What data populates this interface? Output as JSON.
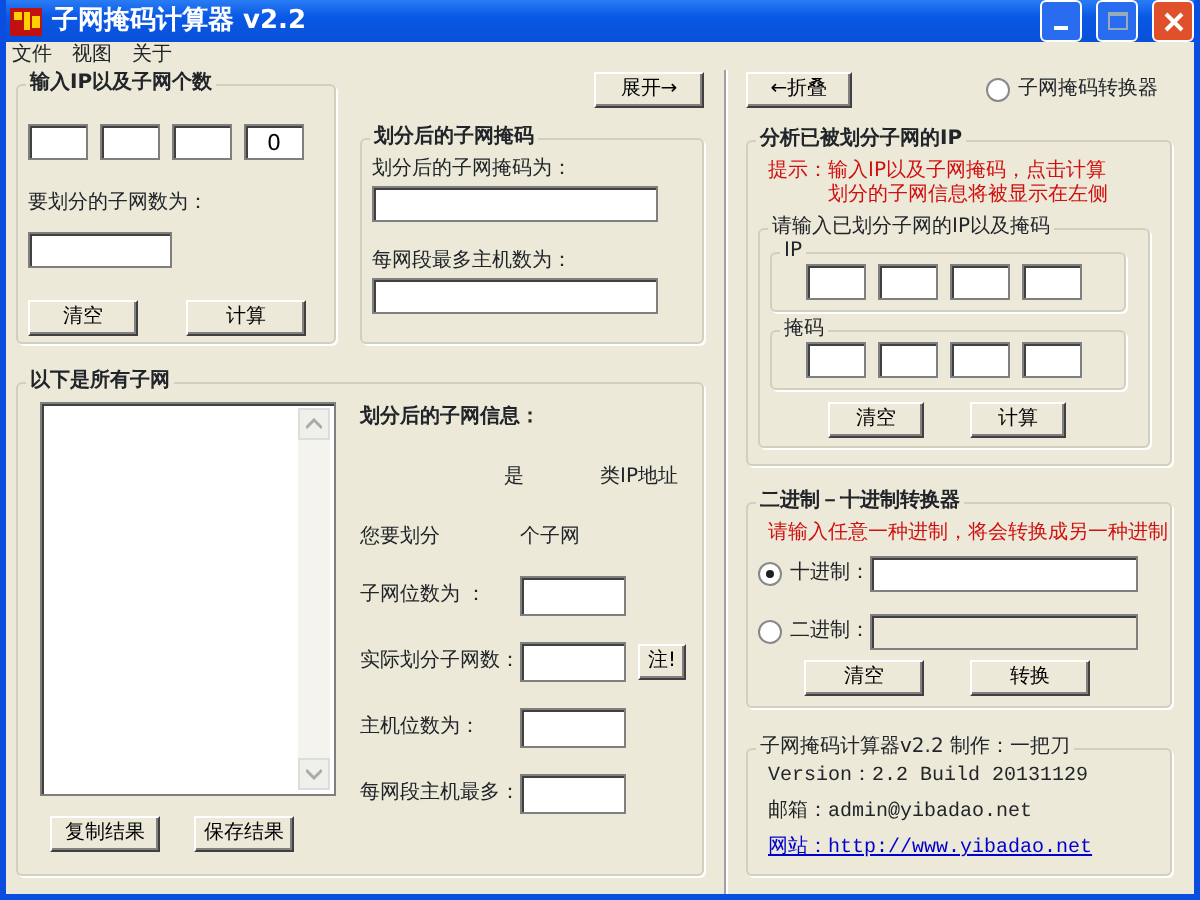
{
  "window": {
    "title": "子网掩码计算器 v2.2"
  },
  "menu": [
    "文件",
    "视图",
    "关于"
  ],
  "ip_group": {
    "title": "输入IP以及子网个数",
    "ip_field_4": "0",
    "count_label": "要划分的子网数为：",
    "buttons": [
      "清空",
      "计算"
    ]
  },
  "expand_button": "展开→",
  "mask_group": {
    "title": "划分后的子网掩码",
    "fields": [
      {
        "label": "划分后的子网掩码为："
      },
      {
        "label": "每网段最多主机数为："
      }
    ]
  },
  "subnets_group": {
    "title": "以下是所有子网",
    "buttons": [
      "复制结果",
      "保存结果"
    ],
    "info_title": "划分后的子网信息：",
    "class_line": [
      "是",
      "类IP地址"
    ],
    "count_line": [
      "您要划分",
      "个子网"
    ],
    "rows": [
      {
        "label": "子网位数为 ："
      },
      {
        "label": "实际划分子网数：",
        "note_button": "注!"
      },
      {
        "label": "主机位数为："
      },
      {
        "label": "每网段主机最多："
      }
    ]
  },
  "collapse_button": "←折叠",
  "converter_radio": {
    "label": "子网掩码转换器",
    "selected": false
  },
  "analyze_group": {
    "title": "分析已被划分子网的IP",
    "hint_label": "提示：",
    "hint_lines": [
      "输入IP以及子网掩码，点击计算",
      "划分的子网信息将被显示在左侧"
    ],
    "input_group": {
      "title": "请输入已划分子网的IP以及掩码",
      "sets": [
        {
          "title": "IP"
        },
        {
          "title": "掩码"
        }
      ]
    },
    "buttons": [
      "清空",
      "计算"
    ]
  },
  "binary_group": {
    "title": "二进制－十进制转换器",
    "hint": "请输入任意一种进制，将会转换成另一种进制",
    "options": [
      {
        "label": "十进制：",
        "selected": true
      },
      {
        "label": "二进制：",
        "selected": false
      }
    ],
    "buttons": [
      "清空",
      "转换"
    ]
  },
  "about_group": {
    "title": "子网掩码计算器v2.2  制作：一把刀",
    "lines": [
      {
        "kind": "text",
        "text": "Version：2.2  Build 20131129"
      },
      {
        "kind": "text",
        "text": "邮箱：admin@yibadao.net"
      },
      {
        "kind": "link",
        "text": "网站：http://www.yibadao.net"
      }
    ]
  }
}
